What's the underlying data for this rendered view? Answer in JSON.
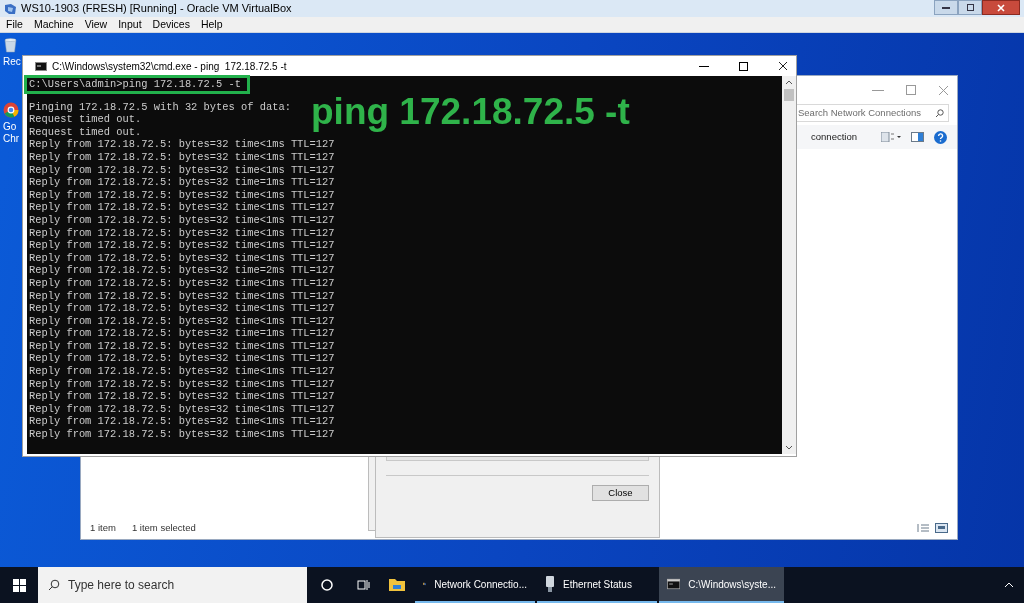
{
  "host_window": {
    "title": "WS10-1903 (FRESH) [Running] - Oracle VM VirtualBox",
    "menu": [
      "File",
      "Machine",
      "View",
      "Input",
      "Devices",
      "Help"
    ]
  },
  "desktop_icons": [
    {
      "kind": "recycle",
      "label": "Rec"
    },
    {
      "kind": "chrome",
      "label": "Go\nChr"
    }
  ],
  "explorer": {
    "search": {
      "placeholder": "Search Network Connections"
    },
    "toolbar_text": "connection",
    "status": [
      "1 item",
      "1 item selected"
    ]
  },
  "dialog": {
    "button": "Close"
  },
  "cmd": {
    "title": "C:\\Windows\\system32\\cmd.exe - ping  172.18.72.5 -t",
    "lines": [
      {
        "text": "C:\\Users\\admin>ping 172.18.72.5 -t",
        "highlighted": true
      },
      {
        "text": "Pinging 172.18.72.5 with 32 bytes of data:",
        "highlighted": false
      },
      {
        "text": "Request timed out.",
        "highlighted": false
      },
      {
        "text": "Request timed out.",
        "highlighted": false
      },
      {
        "text": "Reply from 172.18.72.5: bytes=32 time<1ms TTL=127",
        "highlighted": false
      },
      {
        "text": "Reply from 172.18.72.5: bytes=32 time<1ms TTL=127",
        "highlighted": false
      },
      {
        "text": "Reply from 172.18.72.5: bytes=32 time<1ms TTL=127",
        "highlighted": false
      },
      {
        "text": "Reply from 172.18.72.5: bytes=32 time=1ms TTL=127",
        "highlighted": false
      },
      {
        "text": "Reply from 172.18.72.5: bytes=32 time<1ms TTL=127",
        "highlighted": false
      },
      {
        "text": "Reply from 172.18.72.5: bytes=32 time<1ms TTL=127",
        "highlighted": false
      },
      {
        "text": "Reply from 172.18.72.5: bytes=32 time<1ms TTL=127",
        "highlighted": false
      },
      {
        "text": "Reply from 172.18.72.5: bytes=32 time<1ms TTL=127",
        "highlighted": false
      },
      {
        "text": "Reply from 172.18.72.5: bytes=32 time<1ms TTL=127",
        "highlighted": false
      },
      {
        "text": "Reply from 172.18.72.5: bytes=32 time<1ms TTL=127",
        "highlighted": false
      },
      {
        "text": "Reply from 172.18.72.5: bytes=32 time=2ms TTL=127",
        "highlighted": false
      },
      {
        "text": "Reply from 172.18.72.5: bytes=32 time<1ms TTL=127",
        "highlighted": false
      },
      {
        "text": "Reply from 172.18.72.5: bytes=32 time<1ms TTL=127",
        "highlighted": false
      },
      {
        "text": "Reply from 172.18.72.5: bytes=32 time<1ms TTL=127",
        "highlighted": false
      },
      {
        "text": "Reply from 172.18.72.5: bytes=32 time<1ms TTL=127",
        "highlighted": false
      },
      {
        "text": "Reply from 172.18.72.5: bytes=32 time=1ms TTL=127",
        "highlighted": false
      },
      {
        "text": "Reply from 172.18.72.5: bytes=32 time<1ms TTL=127",
        "highlighted": false
      },
      {
        "text": "Reply from 172.18.72.5: bytes=32 time<1ms TTL=127",
        "highlighted": false
      },
      {
        "text": "Reply from 172.18.72.5: bytes=32 time<1ms TTL=127",
        "highlighted": false
      },
      {
        "text": "Reply from 172.18.72.5: bytes=32 time<1ms TTL=127",
        "highlighted": false
      },
      {
        "text": "Reply from 172.18.72.5: bytes=32 time<1ms TTL=127",
        "highlighted": false
      },
      {
        "text": "Reply from 172.18.72.5: bytes=32 time<1ms TTL=127",
        "highlighted": false
      },
      {
        "text": "Reply from 172.18.72.5: bytes=32 time<1ms TTL=127",
        "highlighted": false
      },
      {
        "text": "Reply from 172.18.72.5: bytes=32 time<1ms TTL=127",
        "highlighted": false
      }
    ],
    "annotation": "ping 172.18.72.5 -t"
  },
  "taskbar": {
    "search": {
      "placeholder": "Type here to search"
    },
    "apps": [
      {
        "kind": "network",
        "label": "Network Connectio...",
        "selected": false
      },
      {
        "kind": "ethernet",
        "label": "Ethernet Status",
        "selected": false
      },
      {
        "kind": "cmd",
        "label": "C:\\Windows\\syste...",
        "selected": true
      }
    ]
  }
}
